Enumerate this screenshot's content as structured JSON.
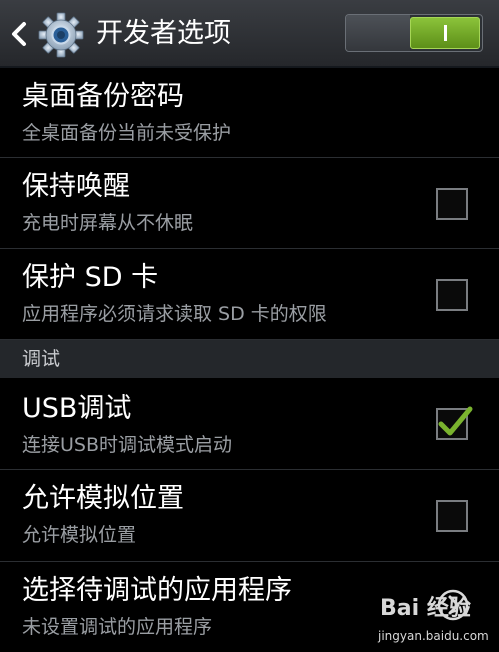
{
  "header": {
    "title": "开发者选项",
    "back_icon": "chevron-left-icon",
    "settings_icon": "gear-icon",
    "toggle_state": "on",
    "toggle_color": "#7ab32e"
  },
  "rows": [
    {
      "title": "桌面备份密码",
      "subtitle": "全桌面备份当前未受保护"
    },
    {
      "title": "保持唤醒",
      "subtitle": "充电时屏幕从不休眠",
      "checked": false
    },
    {
      "title": "保护 SD 卡",
      "subtitle": "应用程序必须请求读取 SD 卡的权限",
      "checked": false
    }
  ],
  "section": {
    "label": "调试"
  },
  "debug_rows": [
    {
      "title": "USB调试",
      "subtitle": "连接USB时调试模式启动",
      "checked": true,
      "check_color": "#7ab32e"
    },
    {
      "title": "允许模拟位置",
      "subtitle": "允许模拟位置",
      "checked": false
    },
    {
      "title": "选择待调试的应用程序",
      "subtitle": "未设置调试的应用程序"
    }
  ],
  "watermark": {
    "brand": "Bai 经验",
    "url": "jingyan.baidu.com"
  }
}
